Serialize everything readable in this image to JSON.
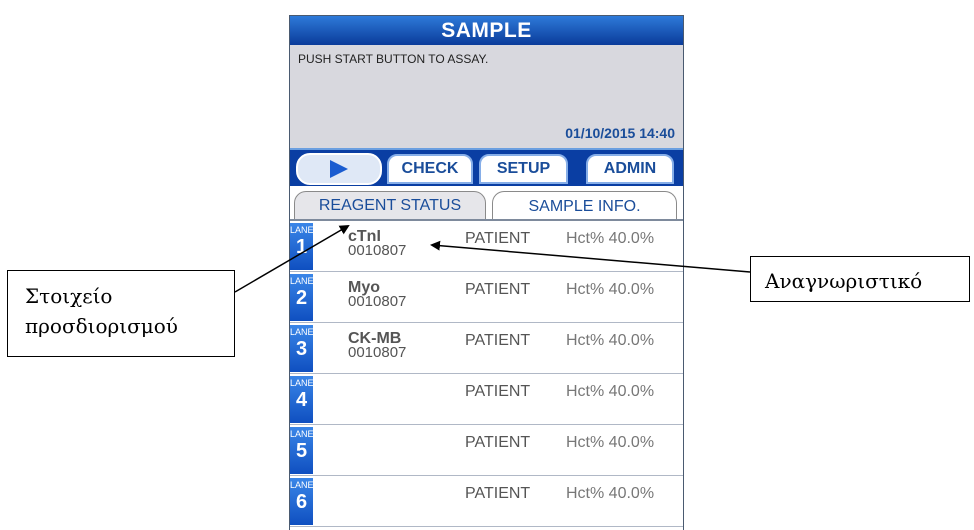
{
  "screen": {
    "title": "SAMPLE",
    "message": "PUSH START BUTTON TO ASSAY.",
    "datetime": "01/10/2015 14:40"
  },
  "menu": {
    "start_icon": "play-icon",
    "check": "CHECK",
    "setup": "SETUP",
    "admin": "ADMIN"
  },
  "tabs": {
    "reagent_status": "REAGENT STATUS",
    "sample_info": "SAMPLE INFO.",
    "active": "sample_info"
  },
  "lanes": [
    {
      "caption": "LANE",
      "number": "1",
      "analyte": "cTnI",
      "sample_id": "0010807",
      "type": "PATIENT",
      "hct": "Hct% 40.0%"
    },
    {
      "caption": "LANE",
      "number": "2",
      "analyte": "Myo",
      "sample_id": "0010807",
      "type": "PATIENT",
      "hct": "Hct% 40.0%"
    },
    {
      "caption": "LANE",
      "number": "3",
      "analyte": "CK-MB",
      "sample_id": "0010807",
      "type": "PATIENT",
      "hct": "Hct% 40.0%"
    },
    {
      "caption": "LANE",
      "number": "4",
      "analyte": "",
      "sample_id": "",
      "type": "PATIENT",
      "hct": "Hct% 40.0%"
    },
    {
      "caption": "LANE",
      "number": "5",
      "analyte": "",
      "sample_id": "",
      "type": "PATIENT",
      "hct": "Hct% 40.0%"
    },
    {
      "caption": "LANE",
      "number": "6",
      "analyte": "",
      "sample_id": "",
      "type": "PATIENT",
      "hct": "Hct% 40.0%"
    }
  ],
  "annotations": {
    "left_label_line1": "Στοιχείο",
    "left_label_line2": "προσδιορισμού",
    "right_label": "Αναγνωριστικό"
  },
  "colors": {
    "title_bar": "#0a3b9a",
    "menu_bar": "#0a3ea3",
    "lane_badge": "#1a5cd0",
    "datetime_text": "#1a4d9a",
    "message_area": "#d8d8de"
  }
}
